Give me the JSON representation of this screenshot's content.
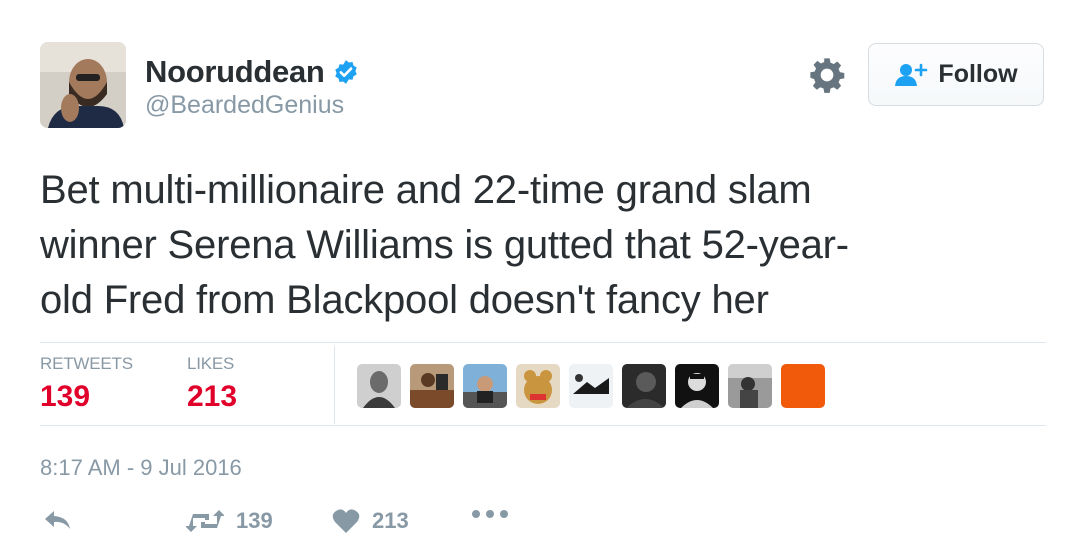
{
  "user": {
    "display_name": "Nooruddean",
    "handle": "@BeardedGenius",
    "verified": true
  },
  "header": {
    "follow_label": "Follow"
  },
  "tweet": {
    "text": "Bet multi-millionaire and 22-time grand slam\nwinner Serena Williams is gutted that 52-year-\nold Fred from Blackpool doesn't fancy her"
  },
  "stats": {
    "retweets_label": "RETWEETS",
    "retweets_value": "139",
    "likes_label": "LIKES",
    "likes_value": "213"
  },
  "likers": [
    {
      "name": "liker-avatar-1"
    },
    {
      "name": "liker-avatar-2"
    },
    {
      "name": "liker-avatar-3"
    },
    {
      "name": "liker-avatar-4"
    },
    {
      "name": "liker-avatar-5"
    },
    {
      "name": "liker-avatar-6"
    },
    {
      "name": "liker-avatar-7"
    },
    {
      "name": "liker-avatar-8"
    },
    {
      "name": "liker-avatar-9"
    }
  ],
  "timestamp": "8:17 AM - 9 Jul 2016",
  "actions": {
    "retweet_count": "139",
    "like_count": "213"
  },
  "colors": {
    "accent_blue": "#1da1f2",
    "stat_red": "#e0002a",
    "muted_gray": "#8899a6",
    "text_dark": "#292f33"
  },
  "icons": [
    "verified-badge-icon",
    "gear-icon",
    "follow-person-icon",
    "reply-icon",
    "retweet-icon",
    "heart-icon",
    "more-icon"
  ]
}
